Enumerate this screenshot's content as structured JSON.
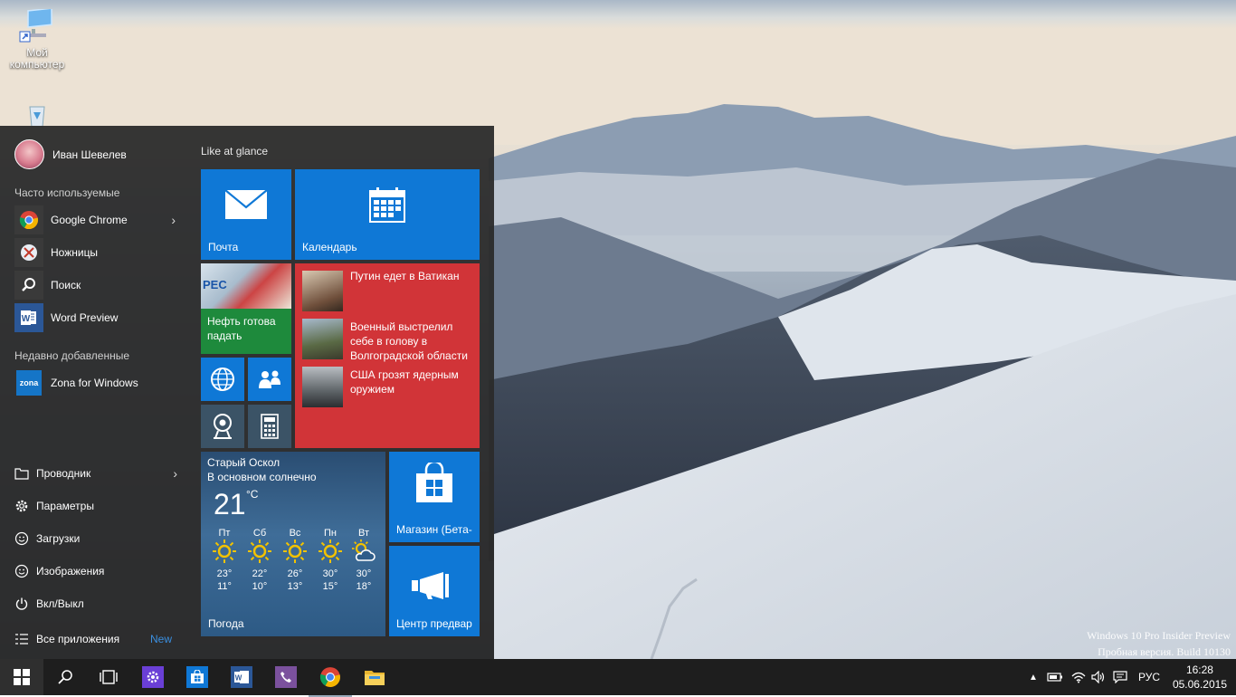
{
  "desktop": {
    "icons": [
      {
        "label": "Мой компьютер",
        "icon": "computer-icon"
      },
      {
        "label": "",
        "icon": "recycle-bin-icon"
      }
    ],
    "watermark_line1": "Windows 10 Pro Insider Preview",
    "watermark_line2": "Пробная версия. Build 10130"
  },
  "start_menu": {
    "user_name": "Иван Шевелев",
    "most_used_header": "Часто используемые",
    "most_used": [
      {
        "label": "Google Chrome",
        "icon": "chrome-icon",
        "has_submenu": true
      },
      {
        "label": "Ножницы",
        "icon": "scissors-icon"
      },
      {
        "label": "Поиск",
        "icon": "search-icon"
      },
      {
        "label": "Word Preview",
        "icon": "word-icon"
      }
    ],
    "recent_header": "Недавно добавленные",
    "recent": [
      {
        "label": "Zona for Windows",
        "icon": "zona-icon",
        "icon_text": "zona"
      }
    ],
    "system": [
      {
        "label": "Проводник",
        "icon": "folder-icon",
        "has_submenu": true
      },
      {
        "label": "Параметры",
        "icon": "gear-icon"
      },
      {
        "label": "Загрузки",
        "icon": "downloads-icon"
      },
      {
        "label": "Изображения",
        "icon": "pictures-icon"
      },
      {
        "label": "Вкл/Выкл",
        "icon": "power-icon"
      }
    ],
    "all_apps_label": "Все приложения",
    "new_badge": "New",
    "group_title": "Like at glance",
    "tiles": {
      "mail": "Почта",
      "calendar": "Календарь",
      "finance_image_text": "РЕС",
      "finance": "Нефть готова падать",
      "news": [
        "Путин едет в Ватикан",
        "Военный выстрелил себе в голову в Волгоградской области",
        "США грозят ядерным оружием"
      ],
      "store": "Магазин (Бета-",
      "feedback": "Центр предвар",
      "weather": {
        "city": "Старый Оскол",
        "condition": "В основном солнечно",
        "temp": "21",
        "unit": "°C",
        "label": "Погода",
        "days": [
          {
            "day": "Пт",
            "hi": "23°",
            "lo": "11°",
            "icon": "sun-icon"
          },
          {
            "day": "Сб",
            "hi": "22°",
            "lo": "10°",
            "icon": "sun-icon"
          },
          {
            "day": "Вс",
            "hi": "26°",
            "lo": "13°",
            "icon": "sun-icon"
          },
          {
            "day": "Пн",
            "hi": "30°",
            "lo": "15°",
            "icon": "sun-icon"
          },
          {
            "day": "Вт",
            "hi": "30°",
            "lo": "18°",
            "icon": "partly-cloudy-icon"
          }
        ]
      }
    }
  },
  "taskbar": {
    "language": "РУС",
    "time": "16:28",
    "date": "05.06.2015"
  },
  "colors": {
    "accent": "#0f78d6",
    "news_tile": "#d13438",
    "finance_tile": "#1e8a3c",
    "start_bg": "#2b2b2b",
    "taskbar_bg": "#1e1e1e"
  }
}
